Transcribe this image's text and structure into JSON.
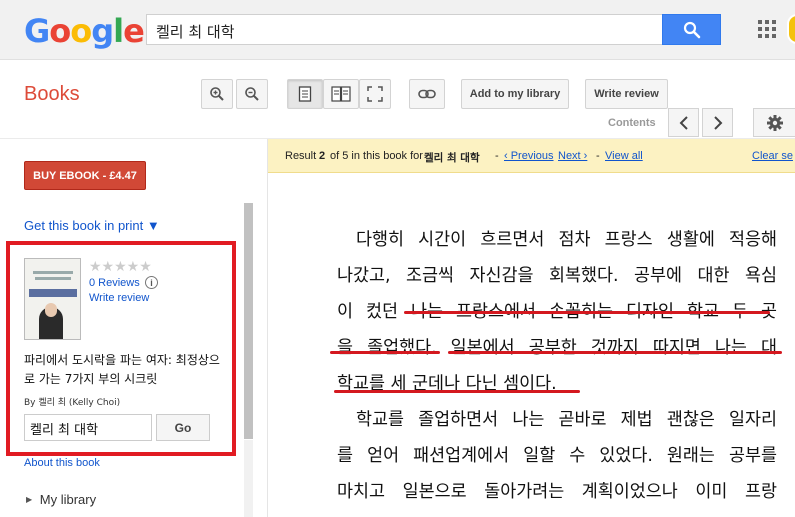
{
  "header": {
    "logo_letters": [
      {
        "ch": "G",
        "color": "#4285f4"
      },
      {
        "ch": "o",
        "color": "#ea4335"
      },
      {
        "ch": "o",
        "color": "#fbbc05"
      },
      {
        "ch": "g",
        "color": "#4285f4"
      },
      {
        "ch": "l",
        "color": "#34a853"
      },
      {
        "ch": "e",
        "color": "#ea4335"
      }
    ],
    "search_value": "켈리 최 대학",
    "search_icon": "magnifier-icon",
    "apps_icon": "apps-grid-icon"
  },
  "toolbar": {
    "section_title": "Books",
    "zoom_in_icon": "zoom-in-icon",
    "zoom_out_icon": "zoom-out-icon",
    "single_page_icon": "single-page-icon",
    "two_page_icon": "two-page-icon",
    "fullscreen_icon": "fullscreen-icon",
    "link_icon": "link-icon",
    "add_library_label": "Add to my library",
    "write_review_label": "Write review",
    "contents_label": "Contents",
    "settings_icon": "gear-icon"
  },
  "sidebar": {
    "buy_label": "BUY EBOOK - £4.47",
    "print_label": "Get this book in print ▼",
    "rating_stars": "★★★★★",
    "reviews_label": "0 Reviews",
    "write_review_label": "Write review",
    "book_title": "파리에서 도시락을 파는 여자: 최정상으로 가는 7가지 부의 시크릿",
    "author": "By 켈리 최 (Kelly Choi)",
    "in_book_search_value": "켈리 최 대학",
    "go_label": "Go",
    "about_label": "About this book",
    "my_library_label": "My library"
  },
  "result_bar": {
    "prefix": "Result",
    "current": "2",
    "middle": "of 5 in this book for",
    "query": "켈리 최 대학",
    "dash": "-",
    "previous_label": "‹ Previous",
    "next_label": "Next ›",
    "view_all_label": "View all",
    "clear_label": "Clear se"
  },
  "page": {
    "lines": [
      "다행히 시간이 흐르면서 점차 프랑스 생활에 적응해",
      "나갔고, 조금씩 자신감을 회복했다. 공부에 대한 욕심",
      "이 컸던 나는 프랑스에서 손꼽히는 디자인 학교 두 곳",
      "을 졸업했다. 일본에서 공부한 것까지 따지면 나는 대",
      "학교를 세 군데나 다닌 셈이다.",
      "학교를 졸업하면서 나는 곧바로 제법 괜찮은 일자리",
      "를 얻어 패션업계에서 일할 수 있었다. 원래는 공부를",
      "마치고 일본으로 돌아가려는 계획이었으나 이미 프랑"
    ],
    "highlight_color": "#d4181f"
  }
}
